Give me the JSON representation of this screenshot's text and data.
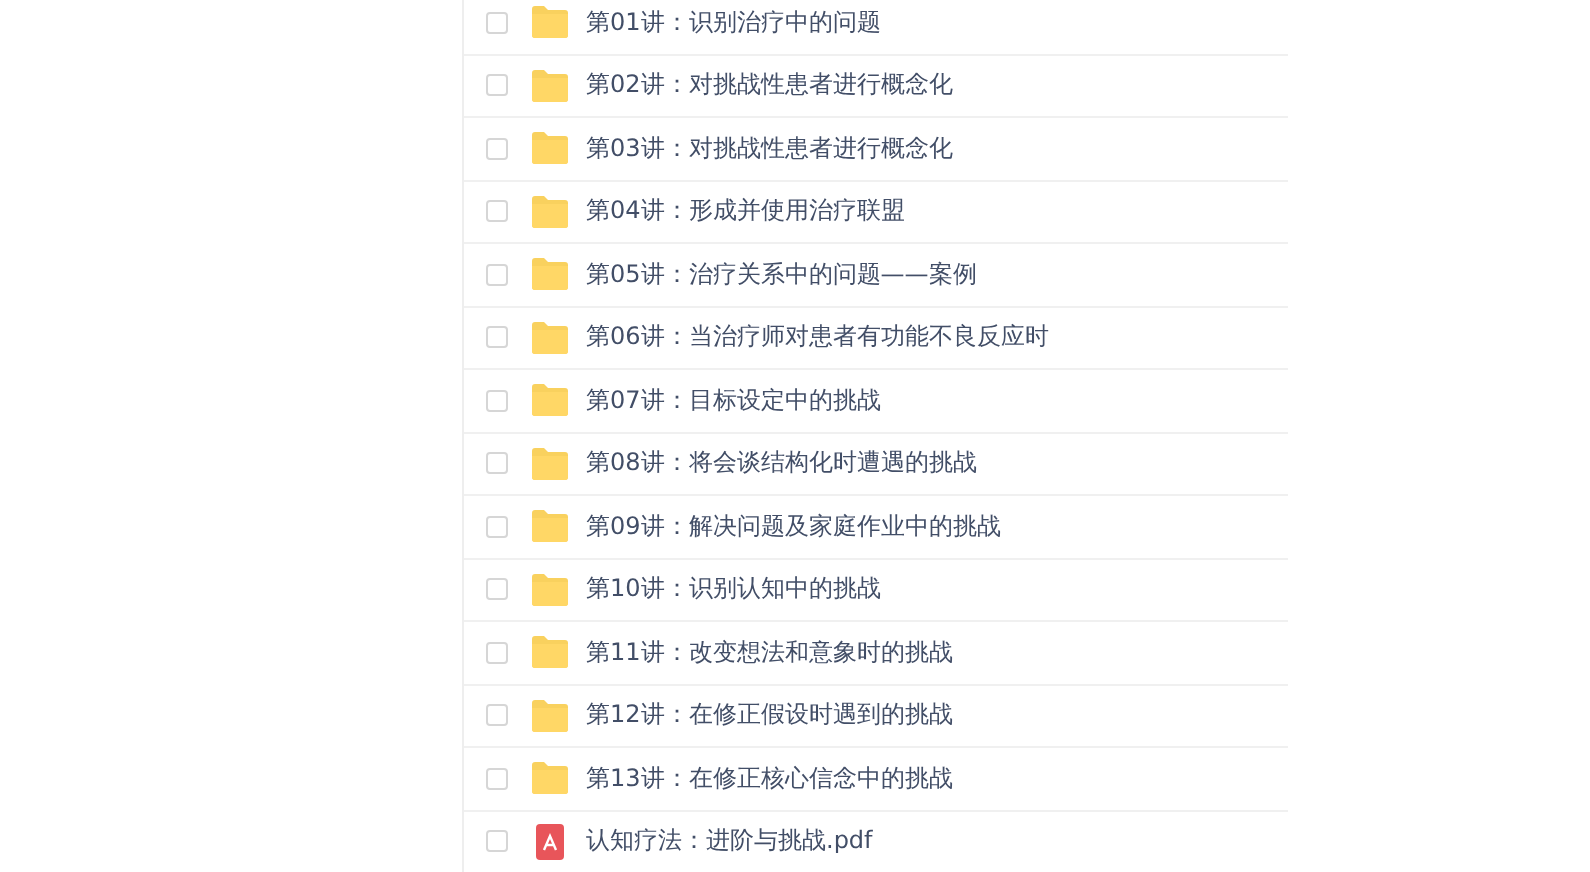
{
  "files": [
    {
      "kind": "folder",
      "name": "第01讲：识别治疗中的问题",
      "checked": false
    },
    {
      "kind": "folder",
      "name": "第02讲：对挑战性患者进行概念化",
      "checked": false
    },
    {
      "kind": "folder",
      "name": "第03讲：对挑战性患者进行概念化",
      "checked": false
    },
    {
      "kind": "folder",
      "name": "第04讲：形成并使用治疗联盟",
      "checked": false
    },
    {
      "kind": "folder",
      "name": "第05讲：治疗关系中的问题——案例",
      "checked": false
    },
    {
      "kind": "folder",
      "name": "第06讲：当治疗师对患者有功能不良反应时",
      "checked": false
    },
    {
      "kind": "folder",
      "name": "第07讲：目标设定中的挑战",
      "checked": false
    },
    {
      "kind": "folder",
      "name": "第08讲：将会谈结构化时遭遇的挑战",
      "checked": false
    },
    {
      "kind": "folder",
      "name": "第09讲：解决问题及家庭作业中的挑战",
      "checked": false
    },
    {
      "kind": "folder",
      "name": "第10讲：识别认知中的挑战",
      "checked": false
    },
    {
      "kind": "folder",
      "name": "第11讲：改变想法和意象时的挑战",
      "checked": false
    },
    {
      "kind": "folder",
      "name": "第12讲：在修正假设时遇到的挑战",
      "checked": false
    },
    {
      "kind": "folder",
      "name": "第13讲：在修正核心信念中的挑战",
      "checked": false
    },
    {
      "kind": "pdf",
      "name": "认知疗法：进阶与挑战.pdf",
      "checked": false
    }
  ]
}
